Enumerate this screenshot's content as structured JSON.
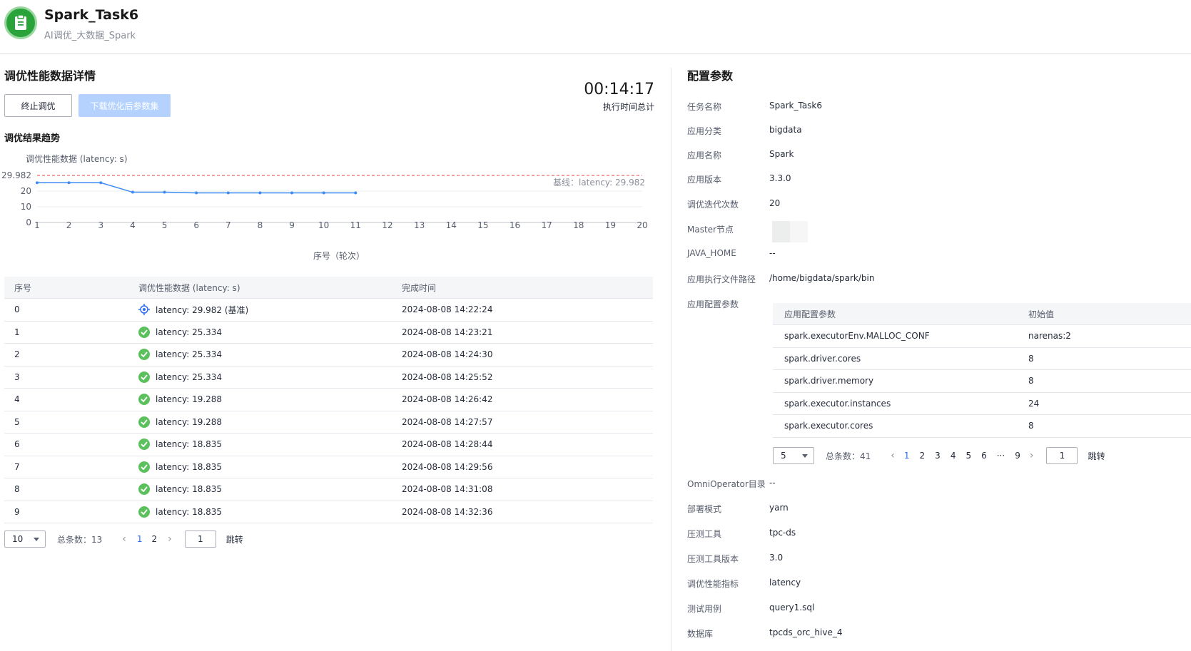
{
  "header": {
    "title": "Spark_Task6",
    "subtitle": "AI调优_大数据_Spark"
  },
  "left": {
    "section_title": "调优性能数据详情",
    "stop_button": "终止调优",
    "download_button": "下载优化后参数集",
    "timer_value": "00:14:17",
    "timer_label": "执行时间总计",
    "trend_title": "调优结果趋势"
  },
  "chart_data": {
    "type": "line",
    "title": "调优性能数据 (latency: s)",
    "xlabel": "序号（轮次）",
    "ylabel": "",
    "x": [
      1,
      2,
      3,
      4,
      5,
      6,
      7,
      8,
      9,
      10,
      11,
      12,
      13,
      14,
      15,
      16,
      17,
      18,
      19,
      20
    ],
    "series": [
      {
        "values": [
          25.334,
          25.334,
          25.334,
          19.288,
          19.288,
          18.835,
          18.835,
          18.835,
          18.835,
          18.835,
          18.835
        ]
      }
    ],
    "baseline": {
      "value": 29.982,
      "label": "基线：latency: 29.982",
      "color": "#e54545"
    },
    "y_ticks": [
      "0",
      "10",
      "20",
      "29.982"
    ],
    "ylim": [
      0,
      29.982
    ],
    "xlim": [
      1,
      20
    ],
    "line_color": "#3d8bf5",
    "grid": true
  },
  "perf_table": {
    "headers": [
      "序号",
      "调优性能数据 (latency: s)",
      "完成时间"
    ],
    "rows": [
      {
        "index": "0",
        "value": "latency: 29.982 (基准)",
        "time": "2024-08-08 14:22:24",
        "icon": "target-icon"
      },
      {
        "index": "1",
        "value": "latency: 25.334",
        "time": "2024-08-08 14:23:21",
        "icon": "check-icon"
      },
      {
        "index": "2",
        "value": "latency: 25.334",
        "time": "2024-08-08 14:24:30",
        "icon": "check-icon"
      },
      {
        "index": "3",
        "value": "latency: 25.334",
        "time": "2024-08-08 14:25:52",
        "icon": "check-icon"
      },
      {
        "index": "4",
        "value": "latency: 19.288",
        "time": "2024-08-08 14:26:42",
        "icon": "check-icon"
      },
      {
        "index": "5",
        "value": "latency: 19.288",
        "time": "2024-08-08 14:27:57",
        "icon": "check-icon"
      },
      {
        "index": "6",
        "value": "latency: 18.835",
        "time": "2024-08-08 14:28:44",
        "icon": "check-icon"
      },
      {
        "index": "7",
        "value": "latency: 18.835",
        "time": "2024-08-08 14:29:56",
        "icon": "check-icon"
      },
      {
        "index": "8",
        "value": "latency: 18.835",
        "time": "2024-08-08 14:31:08",
        "icon": "check-icon"
      },
      {
        "index": "9",
        "value": "latency: 18.835",
        "time": "2024-08-08 14:32:36",
        "icon": "check-icon"
      }
    ]
  },
  "perf_pager": {
    "page_size": "10",
    "total": "总条数：13",
    "pages": [
      "1",
      "2"
    ],
    "current": "1",
    "jump_value": "1",
    "jump_label": "跳转"
  },
  "config": {
    "section_title": "配置参数",
    "items": [
      {
        "label": "任务名称",
        "value": "Spark_Task6"
      },
      {
        "label": "应用分类",
        "value": "bigdata"
      },
      {
        "label": "应用名称",
        "value": "Spark"
      },
      {
        "label": "应用版本",
        "value": "3.3.0"
      },
      {
        "label": "调优迭代次数",
        "value": "20"
      },
      {
        "label": "Master节点",
        "value": ""
      },
      {
        "label": "JAVA_HOME",
        "value": "--"
      },
      {
        "label": "应用执行文件路径",
        "value": "/home/bigdata/spark/bin"
      },
      {
        "label": "应用配置参数",
        "value": ""
      }
    ],
    "items_after": [
      {
        "label": "OmniOperator目录",
        "value": "--"
      },
      {
        "label": "部署模式",
        "value": "yarn"
      },
      {
        "label": "压测工具",
        "value": "tpc-ds"
      },
      {
        "label": "压测工具版本",
        "value": "3.0"
      },
      {
        "label": "调优性能指标",
        "value": "latency"
      },
      {
        "label": "测试用例",
        "value": "query1.sql"
      },
      {
        "label": "数据库",
        "value": "tpcds_orc_hive_4"
      }
    ],
    "param_table": {
      "headers": [
        "应用配置参数",
        "初始值"
      ],
      "rows": [
        {
          "name": "spark.executorEnv.MALLOC_CONF",
          "value": "narenas:2"
        },
        {
          "name": "spark.driver.cores",
          "value": "8"
        },
        {
          "name": "spark.driver.memory",
          "value": "8"
        },
        {
          "name": "spark.executor.instances",
          "value": "24"
        },
        {
          "name": "spark.executor.cores",
          "value": "8"
        }
      ]
    },
    "param_pager": {
      "page_size": "5",
      "total": "总条数：41",
      "pages": [
        "1",
        "2",
        "3",
        "4",
        "5",
        "6",
        "···",
        "9"
      ],
      "current": "1",
      "jump_value": "1",
      "jump_label": "跳转"
    }
  }
}
